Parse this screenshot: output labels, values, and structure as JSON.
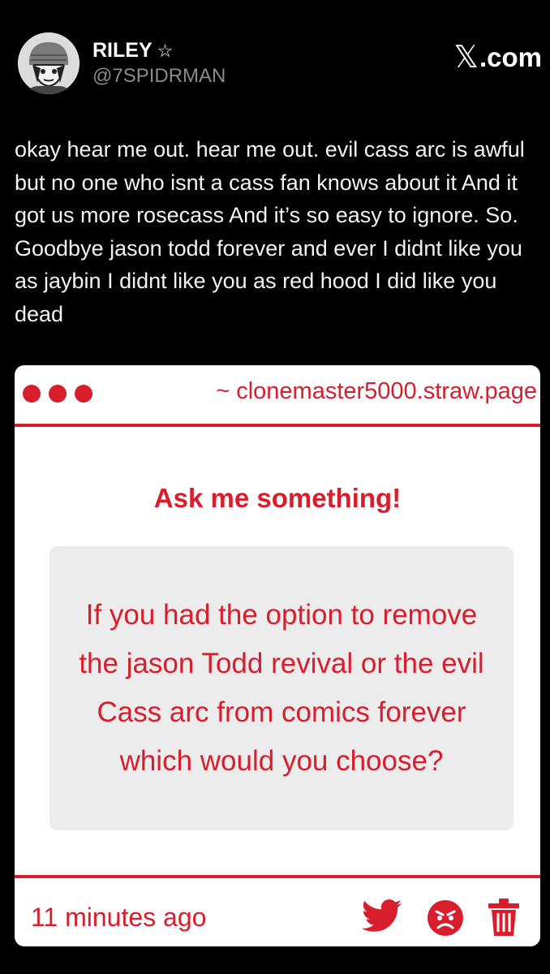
{
  "tweet": {
    "display_name": "RILEY",
    "star": "☆",
    "handle": "@7SPIDRMAN",
    "site_label": ".com",
    "site_logo": "𝕏",
    "text": "okay hear me out. hear me out. evil cass arc is awful but no one who isnt a cass fan knows about it And it got us more rosecass And it’s so easy to ignore. So. Goodbye jason todd forever and ever I didnt like you as jaybin I didnt like you as red hood I did like you dead"
  },
  "card": {
    "url": "~ clonemaster5000.straw.page",
    "title": "Ask me something!",
    "question": "If you had the option to remove the jason Todd revival or the evil Cass arc from comics forever which would you choose?",
    "timestamp": "11 minutes ago",
    "icons": [
      "twitter-bird-icon",
      "angry-face-icon",
      "trash-icon"
    ],
    "accent_color": "#d81d2c"
  }
}
